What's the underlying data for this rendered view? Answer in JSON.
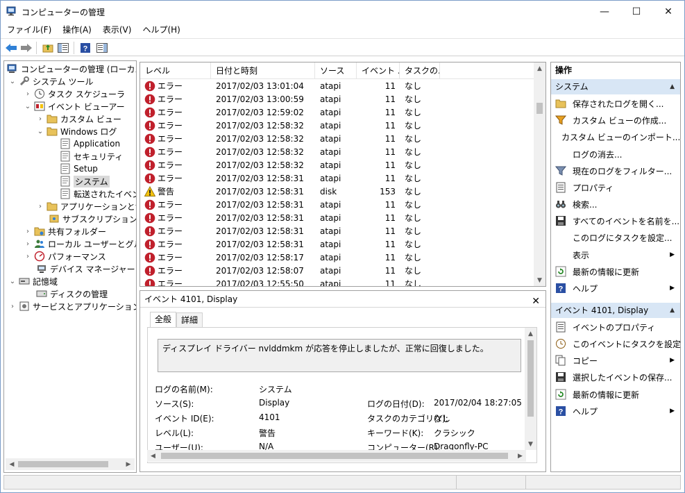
{
  "window": {
    "title": "コンピューターの管理",
    "controls": {
      "minimize": "—",
      "maximize": "☐",
      "close": "✕"
    }
  },
  "menu": [
    "ファイル(F)",
    "操作(A)",
    "表示(V)",
    "ヘルプ(H)"
  ],
  "tree": {
    "root": "コンピューターの管理 (ローカル)",
    "system_tools": "システム ツール",
    "task_scheduler": "タスク スケジューラ",
    "event_viewer": "イベント ビューアー",
    "custom_views": "カスタム ビュー",
    "windows_logs": "Windows ログ",
    "log_application": "Application",
    "log_security": "セキュリティ",
    "log_setup": "Setup",
    "log_system": "システム",
    "log_forwarded": "転送されたイベント",
    "apps_services": "アプリケーションとサービ",
    "subscriptions": "サブスクリプション",
    "shared_folders": "共有フォルダー",
    "local_users": "ローカル ユーザーとグループ",
    "performance": "パフォーマンス",
    "device_manager": "デバイス マネージャー",
    "storage": "記憶域",
    "disk_management": "ディスクの管理",
    "services_apps": "サービスとアプリケーション"
  },
  "event_list": {
    "headers": {
      "level": "レベル",
      "date": "日付と時刻",
      "source": "ソース",
      "event_id": "イベント ...",
      "task": "タスクの..."
    },
    "rows": [
      {
        "level": "エラー",
        "type": "error",
        "date": "2017/02/03 13:01:04",
        "source": "atapi",
        "id": "11",
        "task": "なし"
      },
      {
        "level": "エラー",
        "type": "error",
        "date": "2017/02/03 13:00:59",
        "source": "atapi",
        "id": "11",
        "task": "なし"
      },
      {
        "level": "エラー",
        "type": "error",
        "date": "2017/02/03 12:59:02",
        "source": "atapi",
        "id": "11",
        "task": "なし"
      },
      {
        "level": "エラー",
        "type": "error",
        "date": "2017/02/03 12:58:32",
        "source": "atapi",
        "id": "11",
        "task": "なし"
      },
      {
        "level": "エラー",
        "type": "error",
        "date": "2017/02/03 12:58:32",
        "source": "atapi",
        "id": "11",
        "task": "なし"
      },
      {
        "level": "エラー",
        "type": "error",
        "date": "2017/02/03 12:58:32",
        "source": "atapi",
        "id": "11",
        "task": "なし"
      },
      {
        "level": "エラー",
        "type": "error",
        "date": "2017/02/03 12:58:32",
        "source": "atapi",
        "id": "11",
        "task": "なし"
      },
      {
        "level": "エラー",
        "type": "error",
        "date": "2017/02/03 12:58:31",
        "source": "atapi",
        "id": "11",
        "task": "なし"
      },
      {
        "level": "警告",
        "type": "warning",
        "date": "2017/02/03 12:58:31",
        "source": "disk",
        "id": "153",
        "task": "なし"
      },
      {
        "level": "エラー",
        "type": "error",
        "date": "2017/02/03 12:58:31",
        "source": "atapi",
        "id": "11",
        "task": "なし"
      },
      {
        "level": "エラー",
        "type": "error",
        "date": "2017/02/03 12:58:31",
        "source": "atapi",
        "id": "11",
        "task": "なし"
      },
      {
        "level": "エラー",
        "type": "error",
        "date": "2017/02/03 12:58:31",
        "source": "atapi",
        "id": "11",
        "task": "なし"
      },
      {
        "level": "エラー",
        "type": "error",
        "date": "2017/02/03 12:58:31",
        "source": "atapi",
        "id": "11",
        "task": "なし"
      },
      {
        "level": "エラー",
        "type": "error",
        "date": "2017/02/03 12:58:17",
        "source": "atapi",
        "id": "11",
        "task": "なし"
      },
      {
        "level": "エラー",
        "type": "error",
        "date": "2017/02/03 12:58:07",
        "source": "atapi",
        "id": "11",
        "task": "なし"
      },
      {
        "level": "エラー",
        "type": "error",
        "date": "2017/02/03 12:55:50",
        "source": "atapi",
        "id": "11",
        "task": "なし"
      }
    ]
  },
  "detail": {
    "title": "イベント 4101, Display",
    "close": "✕",
    "tab_general": "全般",
    "tab_details": "詳細",
    "message": "ディスプレイ ドライバー nvlddmkm が応答を停止しましたが、正常に回復しました。",
    "log_name_label": "ログの名前(M):",
    "log_name_value": "システム",
    "source_label": "ソース(S):",
    "source_value": "Display",
    "logged_label": "ログの日付(D):",
    "logged_value": "2017/02/04 18:27:05",
    "event_id_label": "イベント ID(E):",
    "event_id_value": "4101",
    "task_category_label": "タスクのカテゴリ(Y):",
    "task_category_value": "なし",
    "level_label": "レベル(L):",
    "level_value": "警告",
    "keywords_label": "キーワード(K):",
    "keywords_value": "クラシック",
    "user_label": "ユーザー(U):",
    "user_value": "N/A",
    "computer_label": "コンピューター(R):",
    "computer_value": "Dragonfly-PC"
  },
  "actions": {
    "header": "操作",
    "section_system": "システム",
    "system_items": [
      "保存されたログを開く...",
      "カスタム ビューの作成...",
      "カスタム ビューのインポート...",
      "ログの消去...",
      "現在のログをフィルター...",
      "プロパティ",
      "検索...",
      "すべてのイベントを名前を...",
      "このログにタスクを設定...",
      "表示",
      "最新の情報に更新",
      "ヘルプ"
    ],
    "section_event": "イベント 4101, Display",
    "event_items": [
      "イベントのプロパティ",
      "このイベントにタスクを設定...",
      "コピー",
      "選択したイベントの保存...",
      "最新の情報に更新",
      "ヘルプ"
    ]
  },
  "colors": {
    "error": "#c0202c",
    "warning": "#f4c20d",
    "section_bg": "#d8e6f5",
    "selected_bg": "#d9d9d9"
  }
}
